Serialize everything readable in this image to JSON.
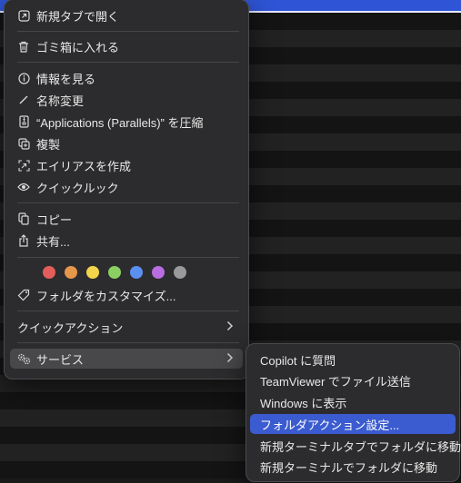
{
  "menu": {
    "items": [
      {
        "label": "新規タブで開く",
        "icon": "open-in-new-tab-icon"
      },
      {
        "label": "ゴミ箱に入れる",
        "icon": "trash-icon"
      },
      {
        "label": "情報を見る",
        "icon": "info-icon"
      },
      {
        "label": "名称変更",
        "icon": "pencil-icon"
      },
      {
        "label": "“Applications (Parallels)” を圧縮",
        "icon": "compress-icon"
      },
      {
        "label": "複製",
        "icon": "duplicate-icon"
      },
      {
        "label": "エイリアスを作成",
        "icon": "alias-icon"
      },
      {
        "label": "クイックルック",
        "icon": "eye-icon"
      },
      {
        "label": "コピー",
        "icon": "copy-icon"
      },
      {
        "label": "共有...",
        "icon": "share-icon"
      },
      {
        "label": "フォルダをカスタマイズ...",
        "icon": "tag-icon"
      },
      {
        "label": "クイックアクション",
        "icon": "chevron-right-icon"
      },
      {
        "label": "サービス",
        "icon": "services-icon"
      }
    ],
    "tag_colors": [
      "#e35d5b",
      "#e6974b",
      "#f2d54b",
      "#8bcf63",
      "#5b8ff0",
      "#b86de0",
      "#9a9a9a"
    ]
  },
  "submenu": {
    "items": [
      {
        "label": "Copilot に質問"
      },
      {
        "label": "TeamViewer でファイル送信"
      },
      {
        "label": "Windows に表示"
      },
      {
        "label": "フォルダアクション設定..."
      },
      {
        "label": "新規ターミナルタブでフォルダに移動"
      },
      {
        "label": "新規ターミナルでフォルダに移動"
      }
    ],
    "active_index": 3,
    "active_color": "#3b5bd0"
  }
}
